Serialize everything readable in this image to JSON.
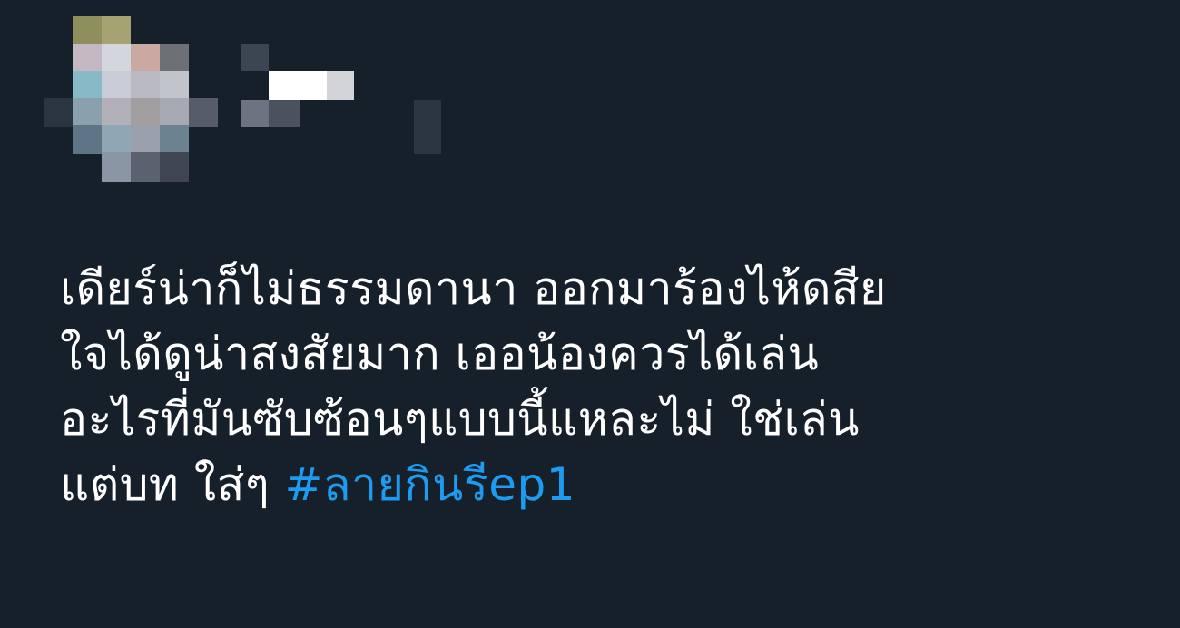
{
  "tweet": {
    "avatar_icon": "blurred-avatar",
    "author_name": "",
    "lines": [
      "เดียร์น่าก็ไม่ธรรมดานา ออกมาร้องไห้ดสีย",
      "ใจได้ดูน่าสงสัยมาก เออน้องควรได้เล่น",
      "อะไรที่มันซับซ้อนๆแบบนี้แหละไม่ ใช่เล่น",
      "แต่บท ใส่ๆ"
    ],
    "hashtag": "#ลายกินรีep1",
    "colors": {
      "background": "#15202b",
      "text": "#ffffff",
      "hashtag": "#1d9bf0"
    }
  }
}
